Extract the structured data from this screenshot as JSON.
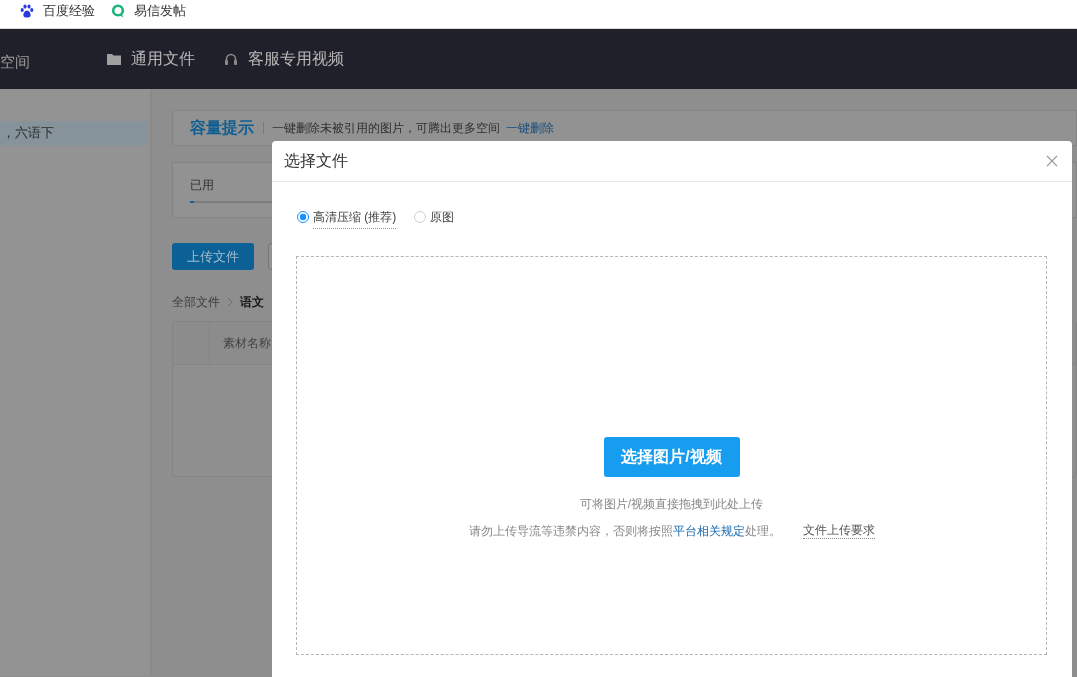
{
  "bookmarks_bar": {
    "items": [
      {
        "kind": "paw",
        "label": "百度经验"
      },
      {
        "kind": "ring",
        "label": "易信发帖"
      }
    ]
  },
  "top_nav": {
    "left_label": "空间",
    "items": [
      {
        "kind": "folder",
        "label": "通用文件"
      },
      {
        "kind": "headset",
        "label": "客服专用视频"
      }
    ]
  },
  "sidebar": {
    "items": [
      {
        "label": "，六语下",
        "selected": true
      }
    ]
  },
  "capacity_notice": {
    "title": "容量提示",
    "text": "一键删除未被引用的图片，可腾出更多空间",
    "link": "一键删除"
  },
  "usage": {
    "label": "已用",
    "level": 0.01
  },
  "toolbar": {
    "buttons": [
      {
        "kind": "primary",
        "label": "上传文件"
      },
      {
        "kind": "outline"
      }
    ]
  },
  "breadcrumb": {
    "items": [
      {
        "label": "全部文件",
        "current": false
      },
      {
        "label": "语文",
        "current": true
      }
    ]
  },
  "table": {
    "columns": [
      "素材名称"
    ]
  },
  "dialog": {
    "title": "选择文件",
    "options": [
      {
        "label": "高清压缩 (推荐)",
        "selected": true
      },
      {
        "label": "原图",
        "selected": false
      }
    ],
    "upload_button": "选择图片/视频",
    "hint": "可将图片/视频直接拖拽到此处上传",
    "notice": {
      "text": "请勿上传导流等违禁内容，否则将按照",
      "link": "平台相关规定",
      "text_after": "处理。"
    },
    "requirements_link": "文件上传要求"
  }
}
